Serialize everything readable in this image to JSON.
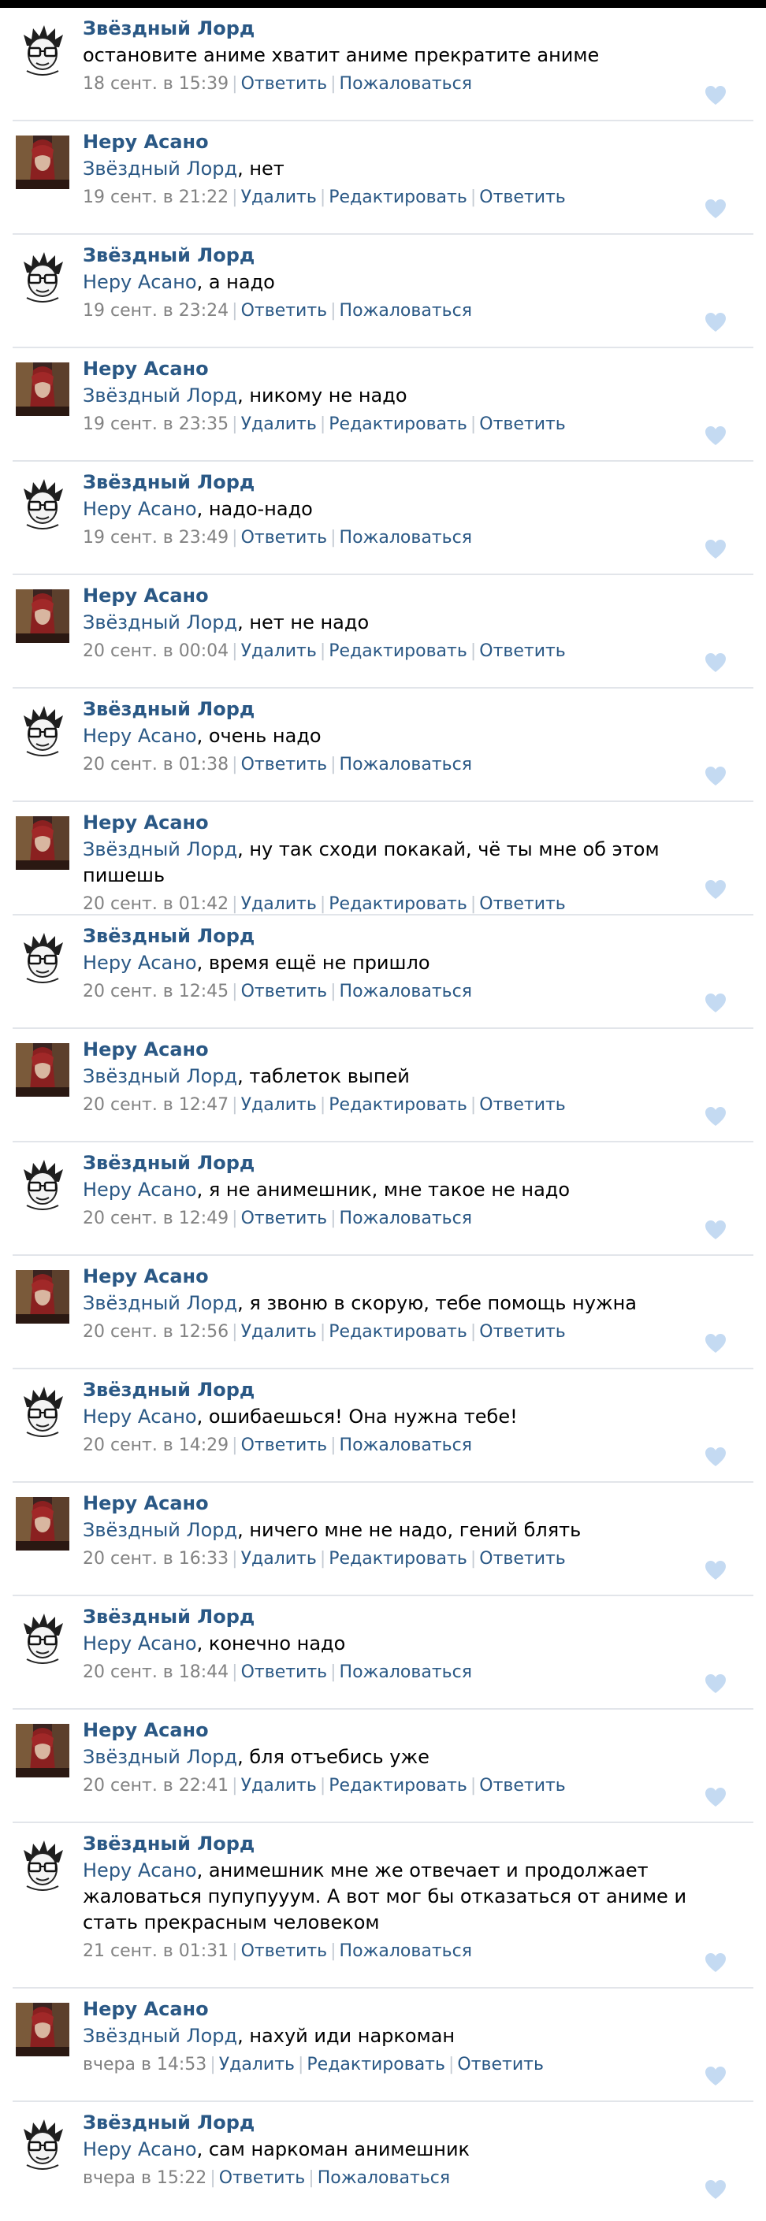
{
  "colors": {
    "link": "#2a5885",
    "meta": "#828282",
    "like": "#c4daf2"
  },
  "icons": {
    "like": "heart-icon"
  },
  "comments": [
    {
      "author": "Звёздный Лорд",
      "avatar": "zvezdny",
      "reply_to": "",
      "text": "остановите аниме хватит аниме прекратите аниме",
      "date": "18 сент. в 15:39",
      "actions": [
        "Ответить",
        "Пожаловаться"
      ]
    },
    {
      "author": "Неру Асано",
      "avatar": "neru",
      "reply_to": "Звёздный Лорд",
      "text": ", нет",
      "date": "19 сент. в 21:22",
      "actions": [
        "Удалить",
        "Редактировать",
        "Ответить"
      ]
    },
    {
      "author": "Звёздный Лорд",
      "avatar": "zvezdny",
      "reply_to": "Неру Асано",
      "text": ", а надо",
      "date": "19 сент. в 23:24",
      "actions": [
        "Ответить",
        "Пожаловаться"
      ]
    },
    {
      "author": "Неру Асано",
      "avatar": "neru",
      "reply_to": "Звёздный Лорд",
      "text": ", никому не надо",
      "date": "19 сент. в 23:35",
      "actions": [
        "Удалить",
        "Редактировать",
        "Ответить"
      ]
    },
    {
      "author": "Звёздный Лорд",
      "avatar": "zvezdny",
      "reply_to": "Неру Асано",
      "text": ", надо-надо",
      "date": "19 сент. в 23:49",
      "actions": [
        "Ответить",
        "Пожаловаться"
      ]
    },
    {
      "author": "Неру Асано",
      "avatar": "neru",
      "reply_to": "Звёздный Лорд",
      "text": ", нет не надо",
      "date": "20 сент. в 00:04",
      "actions": [
        "Удалить",
        "Редактировать",
        "Ответить"
      ]
    },
    {
      "author": "Звёздный Лорд",
      "avatar": "zvezdny",
      "reply_to": "Неру Асано",
      "text": ", очень надо",
      "date": "20 сент. в 01:38",
      "actions": [
        "Ответить",
        "Пожаловаться"
      ]
    },
    {
      "author": "Неру Асано",
      "avatar": "neru",
      "reply_to": "Звёздный Лорд",
      "text": ", ну так сходи покакай, чё ты мне об этом пишешь",
      "date": "20 сент. в 01:42",
      "actions": [
        "Удалить",
        "Редактировать",
        "Ответить"
      ]
    },
    {
      "author": "Звёздный Лорд",
      "avatar": "zvezdny",
      "reply_to": "Неру Асано",
      "text": ", время ещё не пришло",
      "date": "20 сент. в 12:45",
      "actions": [
        "Ответить",
        "Пожаловаться"
      ]
    },
    {
      "author": "Неру Асано",
      "avatar": "neru",
      "reply_to": "Звёздный Лорд",
      "text": ", таблеток выпей",
      "date": "20 сент. в 12:47",
      "actions": [
        "Удалить",
        "Редактировать",
        "Ответить"
      ]
    },
    {
      "author": "Звёздный Лорд",
      "avatar": "zvezdny",
      "reply_to": "Неру Асано",
      "text": ", я не анимешник, мне такое не надо",
      "date": "20 сент. в 12:49",
      "actions": [
        "Ответить",
        "Пожаловаться"
      ]
    },
    {
      "author": "Неру Асано",
      "avatar": "neru",
      "reply_to": "Звёздный Лорд",
      "text": ", я звоню в скорую, тебе помощь нужна",
      "date": "20 сент. в 12:56",
      "actions": [
        "Удалить",
        "Редактировать",
        "Ответить"
      ]
    },
    {
      "author": "Звёздный Лорд",
      "avatar": "zvezdny",
      "reply_to": "Неру Асано",
      "text": ", ошибаешься! Она нужна тебе!",
      "date": "20 сент. в 14:29",
      "actions": [
        "Ответить",
        "Пожаловаться"
      ]
    },
    {
      "author": "Неру Асано",
      "avatar": "neru",
      "reply_to": "Звёздный Лорд",
      "text": ", ничего мне не надо, гений блять",
      "date": "20 сент. в 16:33",
      "actions": [
        "Удалить",
        "Редактировать",
        "Ответить"
      ]
    },
    {
      "author": "Звёздный Лорд",
      "avatar": "zvezdny",
      "reply_to": "Неру Асано",
      "text": ", конечно надо",
      "date": "20 сент. в 18:44",
      "actions": [
        "Ответить",
        "Пожаловаться"
      ]
    },
    {
      "author": "Неру Асано",
      "avatar": "neru",
      "reply_to": "Звёздный Лорд",
      "text": ", бля отъебись уже",
      "date": "20 сент. в 22:41",
      "actions": [
        "Удалить",
        "Редактировать",
        "Ответить"
      ]
    },
    {
      "author": "Звёздный Лорд",
      "avatar": "zvezdny",
      "reply_to": "Неру Асано",
      "text": ", анимешник мне же отвечает и продолжает жаловаться пупупууум. А вот мог бы отказаться от аниме и стать прекрасным человеком",
      "date": "21 сент. в 01:31",
      "actions": [
        "Ответить",
        "Пожаловаться"
      ]
    },
    {
      "author": "Неру Асано",
      "avatar": "neru",
      "reply_to": "Звёздный Лорд",
      "text": ", нахуй иди наркоман",
      "date": "вчера в 14:53",
      "actions": [
        "Удалить",
        "Редактировать",
        "Ответить"
      ]
    },
    {
      "author": "Звёздный Лорд",
      "avatar": "zvezdny",
      "reply_to": "Неру Асано",
      "text": ", сам наркоман анимешник",
      "date": "вчера в 15:22",
      "actions": [
        "Ответить",
        "Пожаловаться"
      ]
    }
  ]
}
